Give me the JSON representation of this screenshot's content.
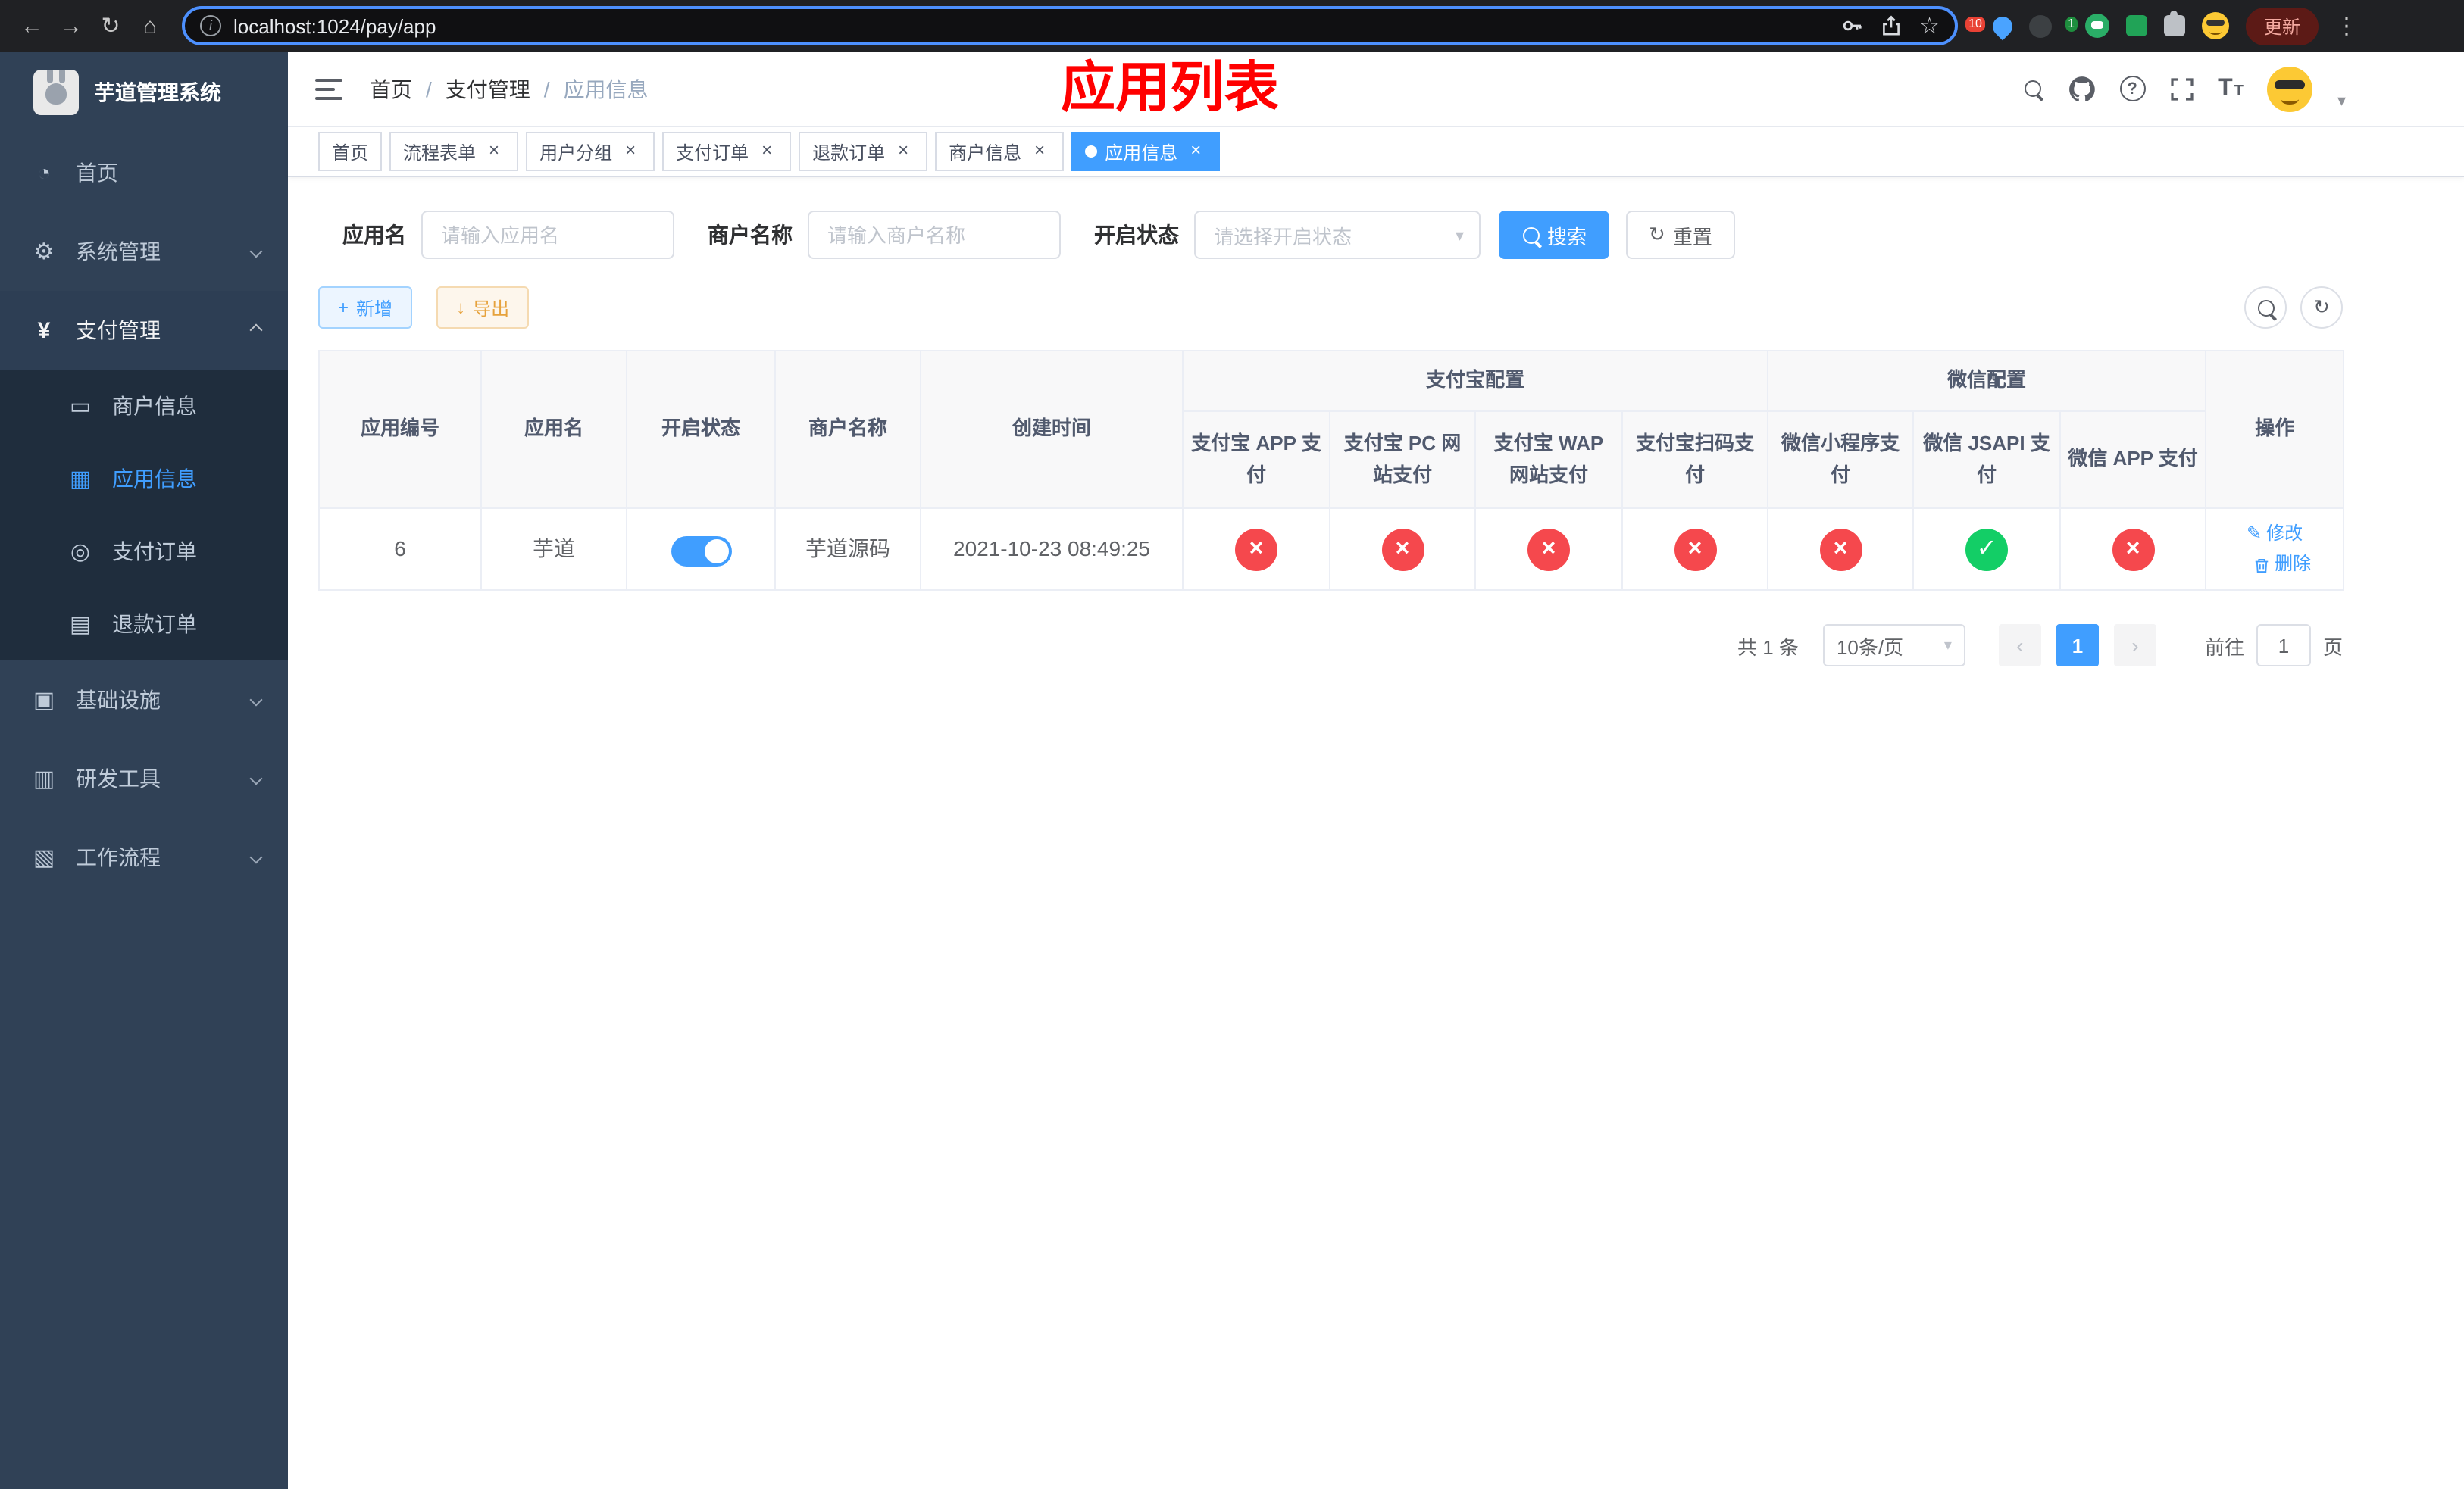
{
  "browser": {
    "url": "localhost:1024/pay/app",
    "update_label": "更新",
    "ext_badge_count": "10",
    "profile_badge_count": "1"
  },
  "icons": {
    "back": "←",
    "forward": "→",
    "reload": "↻",
    "home": "⌂",
    "info": "i",
    "star": "☆",
    "menu_dots": "⋮",
    "close": "×",
    "plus": "+",
    "download": "↓",
    "refresh": "↻",
    "check": "✓",
    "cross": "×",
    "caret": "▾",
    "edit": "✎",
    "question": "?",
    "yen": "¥",
    "gear": "⚙",
    "dashboard": "◔",
    "card": "▭",
    "grid": "▦",
    "order": "◎",
    "doc": "▤",
    "infra": "▣",
    "tool": "▥",
    "flow": "▧",
    "prev": "‹",
    "next": "›",
    "tsize_big": "T",
    "tsize_small": "T"
  },
  "sidebar": {
    "logo_title": "芋道管理系统",
    "items": [
      {
        "label": "首页"
      },
      {
        "label": "系统管理"
      },
      {
        "label": "支付管理",
        "children": [
          {
            "label": "商户信息"
          },
          {
            "label": "应用信息"
          },
          {
            "label": "支付订单"
          },
          {
            "label": "退款订单"
          }
        ]
      },
      {
        "label": "基础设施"
      },
      {
        "label": "研发工具"
      },
      {
        "label": "工作流程"
      }
    ]
  },
  "header": {
    "breadcrumb": [
      "首页",
      "支付管理",
      "应用信息"
    ],
    "separator": "/",
    "annotation": "应用列表"
  },
  "tabs": [
    {
      "label": "首页"
    },
    {
      "label": "流程表单"
    },
    {
      "label": "用户分组"
    },
    {
      "label": "支付订单"
    },
    {
      "label": "退款订单"
    },
    {
      "label": "商户信息"
    },
    {
      "label": "应用信息"
    }
  ],
  "filters": {
    "app_name_label": "应用名",
    "app_name_placeholder": "请输入应用名",
    "merchant_label": "商户名称",
    "merchant_placeholder": "请输入商户名称",
    "status_label": "开启状态",
    "status_placeholder": "请选择开启状态",
    "search_label": "搜索",
    "reset_label": "重置"
  },
  "actions": {
    "add_label": "新增",
    "export_label": "导出"
  },
  "table": {
    "group_alipay": "支付宝配置",
    "group_wechat": "微信配置",
    "col_id": "应用编号",
    "col_name": "应用名",
    "col_status": "开启状态",
    "col_merchant": "商户名称",
    "col_created": "创建时间",
    "col_alipay_app": "支付宝 APP 支付",
    "col_alipay_pc": "支付宝 PC 网站支付",
    "col_alipay_wap": "支付宝 WAP 网站支付",
    "col_alipay_qr": "支付宝扫码支付",
    "col_wx_lite": "微信小程序支付",
    "col_wx_jsapi": "微信 JSAPI 支付",
    "col_wx_app": "微信 APP 支付",
    "col_op": "操作",
    "rows": [
      {
        "id": "6",
        "name": "芋道",
        "enabled": true,
        "merchant": "芋道源码",
        "created": "2021-10-23 08:49:25",
        "alipay_app": false,
        "alipay_pc": false,
        "alipay_wap": false,
        "alipay_qr": false,
        "wx_lite": false,
        "wx_jsapi": true,
        "wx_app": false,
        "edit_label": "修改",
        "delete_label": "删除"
      }
    ]
  },
  "pagination": {
    "total_text": "共 1 条",
    "page_size_text": "10条/页",
    "page": "1",
    "goto_label": "前往",
    "goto_value": "1",
    "page_unit": "页"
  },
  "colors": {
    "primary": "#409eff",
    "danger": "#f5484d",
    "success": "#13ce66",
    "warning": "#e6a23c",
    "annotation": "#ff0000",
    "sidebar_bg": "#304156",
    "submenu_bg": "#1f2d3d"
  }
}
